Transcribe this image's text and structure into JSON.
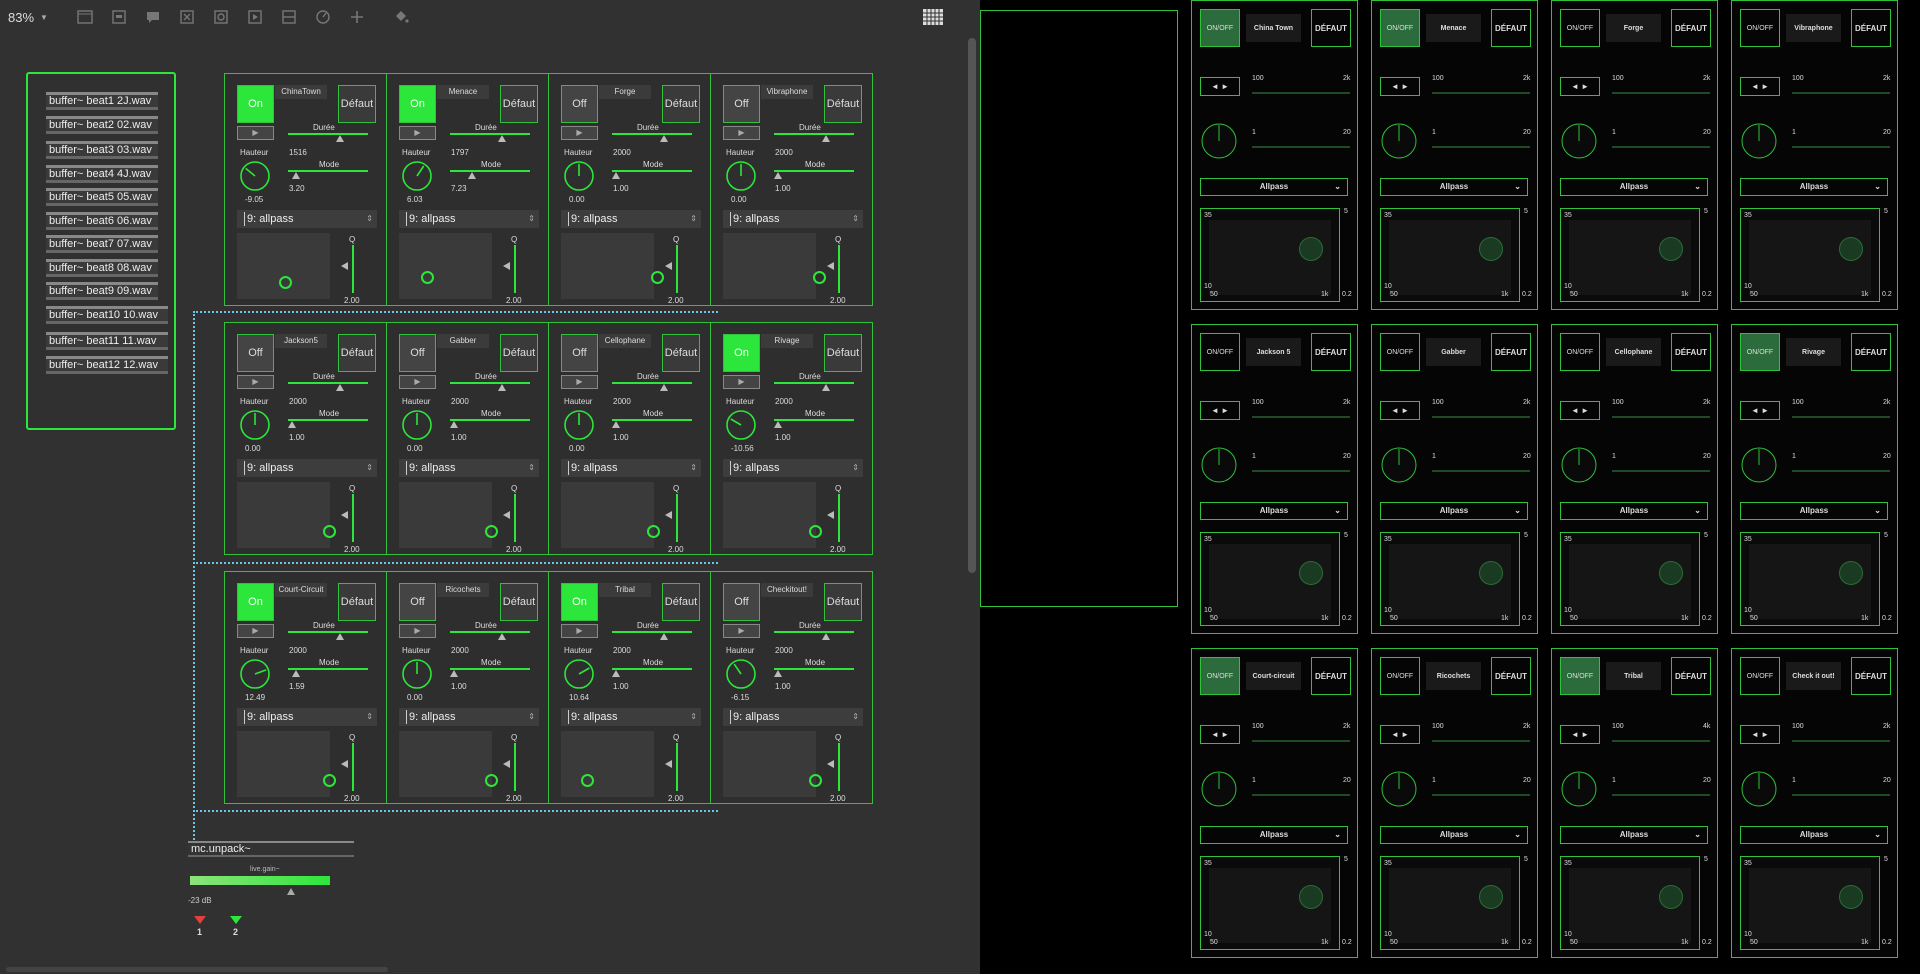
{
  "toolbar": {
    "zoom": "83%"
  },
  "buffers": [
    "buffer~ beat1 2J.wav",
    "buffer~ beat2 02.wav",
    "buffer~ beat3 03.wav",
    "buffer~ beat4 4J.wav",
    "buffer~ beat5 05.wav",
    "buffer~ beat6 06.wav",
    "buffer~ beat7 07.wav",
    "buffer~ beat8 08.wav",
    "buffer~ beat9 09.wav",
    "buffer~ beat10 10.wav",
    "buffer~ beat11 11.wav",
    "buffer~ beat12 12.wav"
  ],
  "modules": [
    {
      "name": "ChinaTown",
      "state": "On",
      "on": true,
      "duration": "1516",
      "pitch": "-9.05",
      "mode": "3.20",
      "filter": "9: allpass",
      "q": "2.00"
    },
    {
      "name": "Menace",
      "state": "On",
      "on": true,
      "duration": "1797",
      "pitch": "6.03",
      "mode": "7.23",
      "filter": "9: allpass",
      "q": "2.00"
    },
    {
      "name": "Forge",
      "state": "Off",
      "on": false,
      "duration": "2000",
      "pitch": "0.00",
      "mode": "1.00",
      "filter": "9: allpass",
      "q": "2.00"
    },
    {
      "name": "Vibraphone",
      "state": "Off",
      "on": false,
      "duration": "2000",
      "pitch": "0.00",
      "mode": "1.00",
      "filter": "9: allpass",
      "q": "2.00"
    },
    {
      "name": "Jackson5",
      "state": "Off",
      "on": false,
      "duration": "2000",
      "pitch": "0.00",
      "mode": "1.00",
      "filter": "9: allpass",
      "q": "2.00"
    },
    {
      "name": "Gabber",
      "state": "Off",
      "on": false,
      "duration": "2000",
      "pitch": "0.00",
      "mode": "1.00",
      "filter": "9: allpass",
      "q": "2.00"
    },
    {
      "name": "Cellophane",
      "state": "Off",
      "on": false,
      "duration": "2000",
      "pitch": "0.00",
      "mode": "1.00",
      "filter": "9: allpass",
      "q": "2.00"
    },
    {
      "name": "Rivage",
      "state": "On",
      "on": true,
      "duration": "2000",
      "pitch": "-10.56",
      "mode": "1.00",
      "filter": "9: allpass",
      "q": "2.00"
    },
    {
      "name": "Court-Circuit",
      "state": "On",
      "on": true,
      "duration": "2000",
      "pitch": "12.49",
      "mode": "1.59",
      "filter": "9: allpass",
      "q": "2.00"
    },
    {
      "name": "Ricochets",
      "state": "Off",
      "on": false,
      "duration": "2000",
      "pitch": "0.00",
      "mode": "1.00",
      "filter": "9: allpass",
      "q": "2.00"
    },
    {
      "name": "Tribal",
      "state": "On",
      "on": true,
      "duration": "2000",
      "pitch": "10.64",
      "mode": "1.00",
      "filter": "9: allpass",
      "q": "2.00"
    },
    {
      "name": "Checkitout!",
      "state": "Off",
      "on": false,
      "duration": "2000",
      "pitch": "-6.15",
      "mode": "1.00",
      "filter": "9: allpass",
      "q": "2.00"
    }
  ],
  "labels": {
    "default": "Défaut",
    "duration": "Durée",
    "pitch": "Hauteur",
    "mode": "Mode",
    "q": "Q",
    "play": "▶"
  },
  "bottom": {
    "unpack": "mc.unpack~",
    "live": "live.gain~",
    "db": "-23 dB",
    "ch1": "1",
    "ch2": "2"
  },
  "presentation": {
    "onoff": "ON/OFF",
    "default": "DÉFAUT",
    "arrows": "◄ ►",
    "select": "Allpass",
    "range_lo": "100",
    "range_hi": "2k",
    "range_hi_alt": "4k",
    "mode_lo": "1",
    "mode_hi": "20",
    "xy_top": "35",
    "xy_bottom": "10",
    "xy_left": "50",
    "xy_right": "1k",
    "q_top": "5",
    "q_bottom": "0.2",
    "modules": [
      {
        "name": "China Town",
        "on": true,
        "hi": "2k"
      },
      {
        "name": "Menace",
        "on": true,
        "hi": "2k"
      },
      {
        "name": "Forge",
        "on": false,
        "hi": "2k"
      },
      {
        "name": "Vibraphone",
        "on": false,
        "hi": "2k"
      },
      {
        "name": "Jackson 5",
        "on": false,
        "hi": "2k"
      },
      {
        "name": "Gabber",
        "on": false,
        "hi": "2k"
      },
      {
        "name": "Cellophane",
        "on": false,
        "hi": "2k"
      },
      {
        "name": "Rivage",
        "on": true,
        "hi": "2k"
      },
      {
        "name": "Court-circuit",
        "on": true,
        "hi": "2k"
      },
      {
        "name": "Ricochets",
        "on": false,
        "hi": "2k"
      },
      {
        "name": "Tribal",
        "on": true,
        "hi": "4k"
      },
      {
        "name": "Check it out!",
        "on": false,
        "hi": "2k"
      }
    ]
  }
}
